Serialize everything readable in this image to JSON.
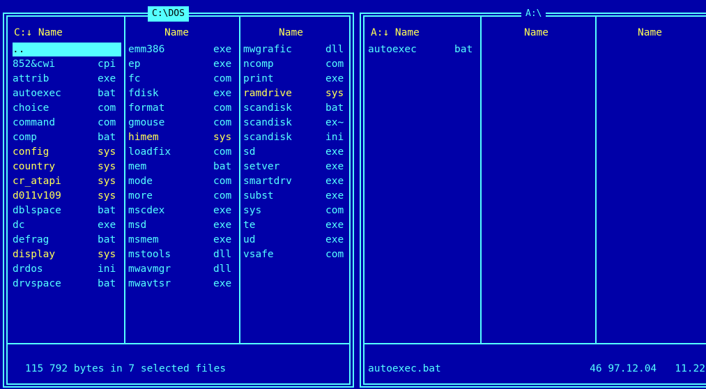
{
  "left": {
    "title": "C:\\DOS",
    "headers": [
      "C:↓ Name",
      "Name",
      "Name"
    ],
    "columns": [
      [
        {
          "n": "..",
          "e": "",
          "k": "cursor"
        },
        {
          "n": "852&cwi",
          "e": "cpi",
          "k": ""
        },
        {
          "n": "attrib",
          "e": "exe",
          "k": ""
        },
        {
          "n": "autoexec",
          "e": "bat",
          "k": ""
        },
        {
          "n": "choice",
          "e": "com",
          "k": ""
        },
        {
          "n": "command",
          "e": "com",
          "k": ""
        },
        {
          "n": "comp",
          "e": "bat",
          "k": ""
        },
        {
          "n": "config",
          "e": "sys",
          "k": "sys"
        },
        {
          "n": "country",
          "e": "sys",
          "k": "sys"
        },
        {
          "n": "cr_atapi",
          "e": "sys",
          "k": "sys"
        },
        {
          "n": "d011v109",
          "e": "sys",
          "k": "sys"
        },
        {
          "n": "dblspace",
          "e": "bat",
          "k": ""
        },
        {
          "n": "dc",
          "e": "exe",
          "k": ""
        },
        {
          "n": "defrag",
          "e": "bat",
          "k": ""
        },
        {
          "n": "display",
          "e": "sys",
          "k": "sys"
        },
        {
          "n": "drdos",
          "e": "ini",
          "k": ""
        },
        {
          "n": "drvspace",
          "e": "bat",
          "k": ""
        }
      ],
      [
        {
          "n": "emm386",
          "e": "exe",
          "k": ""
        },
        {
          "n": "ep",
          "e": "exe",
          "k": ""
        },
        {
          "n": "fc",
          "e": "com",
          "k": ""
        },
        {
          "n": "fdisk",
          "e": "exe",
          "k": ""
        },
        {
          "n": "format",
          "e": "com",
          "k": ""
        },
        {
          "n": "gmouse",
          "e": "com",
          "k": ""
        },
        {
          "n": "himem",
          "e": "sys",
          "k": "sys"
        },
        {
          "n": "loadfix",
          "e": "com",
          "k": ""
        },
        {
          "n": "mem",
          "e": "bat",
          "k": ""
        },
        {
          "n": "mode",
          "e": "com",
          "k": ""
        },
        {
          "n": "more",
          "e": "com",
          "k": ""
        },
        {
          "n": "mscdex",
          "e": "exe",
          "k": ""
        },
        {
          "n": "msd",
          "e": "exe",
          "k": ""
        },
        {
          "n": "msmem",
          "e": "exe",
          "k": ""
        },
        {
          "n": "mstools",
          "e": "dll",
          "k": ""
        },
        {
          "n": "mwavmgr",
          "e": "dll",
          "k": ""
        },
        {
          "n": "mwavtsr",
          "e": "exe",
          "k": ""
        }
      ],
      [
        {
          "n": "mwgrafic",
          "e": "dll",
          "k": ""
        },
        {
          "n": "ncomp",
          "e": "com",
          "k": ""
        },
        {
          "n": "print",
          "e": "exe",
          "k": ""
        },
        {
          "n": "ramdrive",
          "e": "sys",
          "k": "sys"
        },
        {
          "n": "scandisk",
          "e": "bat",
          "k": ""
        },
        {
          "n": "scandisk",
          "e": "ex~",
          "k": ""
        },
        {
          "n": "scandisk",
          "e": "ini",
          "k": ""
        },
        {
          "n": "sd",
          "e": "exe",
          "k": ""
        },
        {
          "n": "setver",
          "e": "exe",
          "k": ""
        },
        {
          "n": "smartdrv",
          "e": "exe",
          "k": ""
        },
        {
          "n": "subst",
          "e": "exe",
          "k": ""
        },
        {
          "n": "sys",
          "e": "com",
          "k": ""
        },
        {
          "n": "te",
          "e": "exe",
          "k": ""
        },
        {
          "n": "ud",
          "e": "exe",
          "k": ""
        },
        {
          "n": "vsafe",
          "e": "com",
          "k": ""
        }
      ]
    ],
    "status": "115 792 bytes in 7 selected files"
  },
  "right": {
    "title": "A:\\",
    "headers": [
      "A:↓ Name",
      "Name",
      "Name"
    ],
    "columns": [
      [
        {
          "n": "autoexec",
          "e": "bat",
          "k": ""
        }
      ],
      [],
      []
    ],
    "status_name": "autoexec.bat",
    "status_info": "46 97.12.04   11.22"
  },
  "colors": {
    "background": "#0000a8",
    "text": "#55ffff",
    "highlight": "#ffff55",
    "cursor_bg": "#55ffff"
  }
}
